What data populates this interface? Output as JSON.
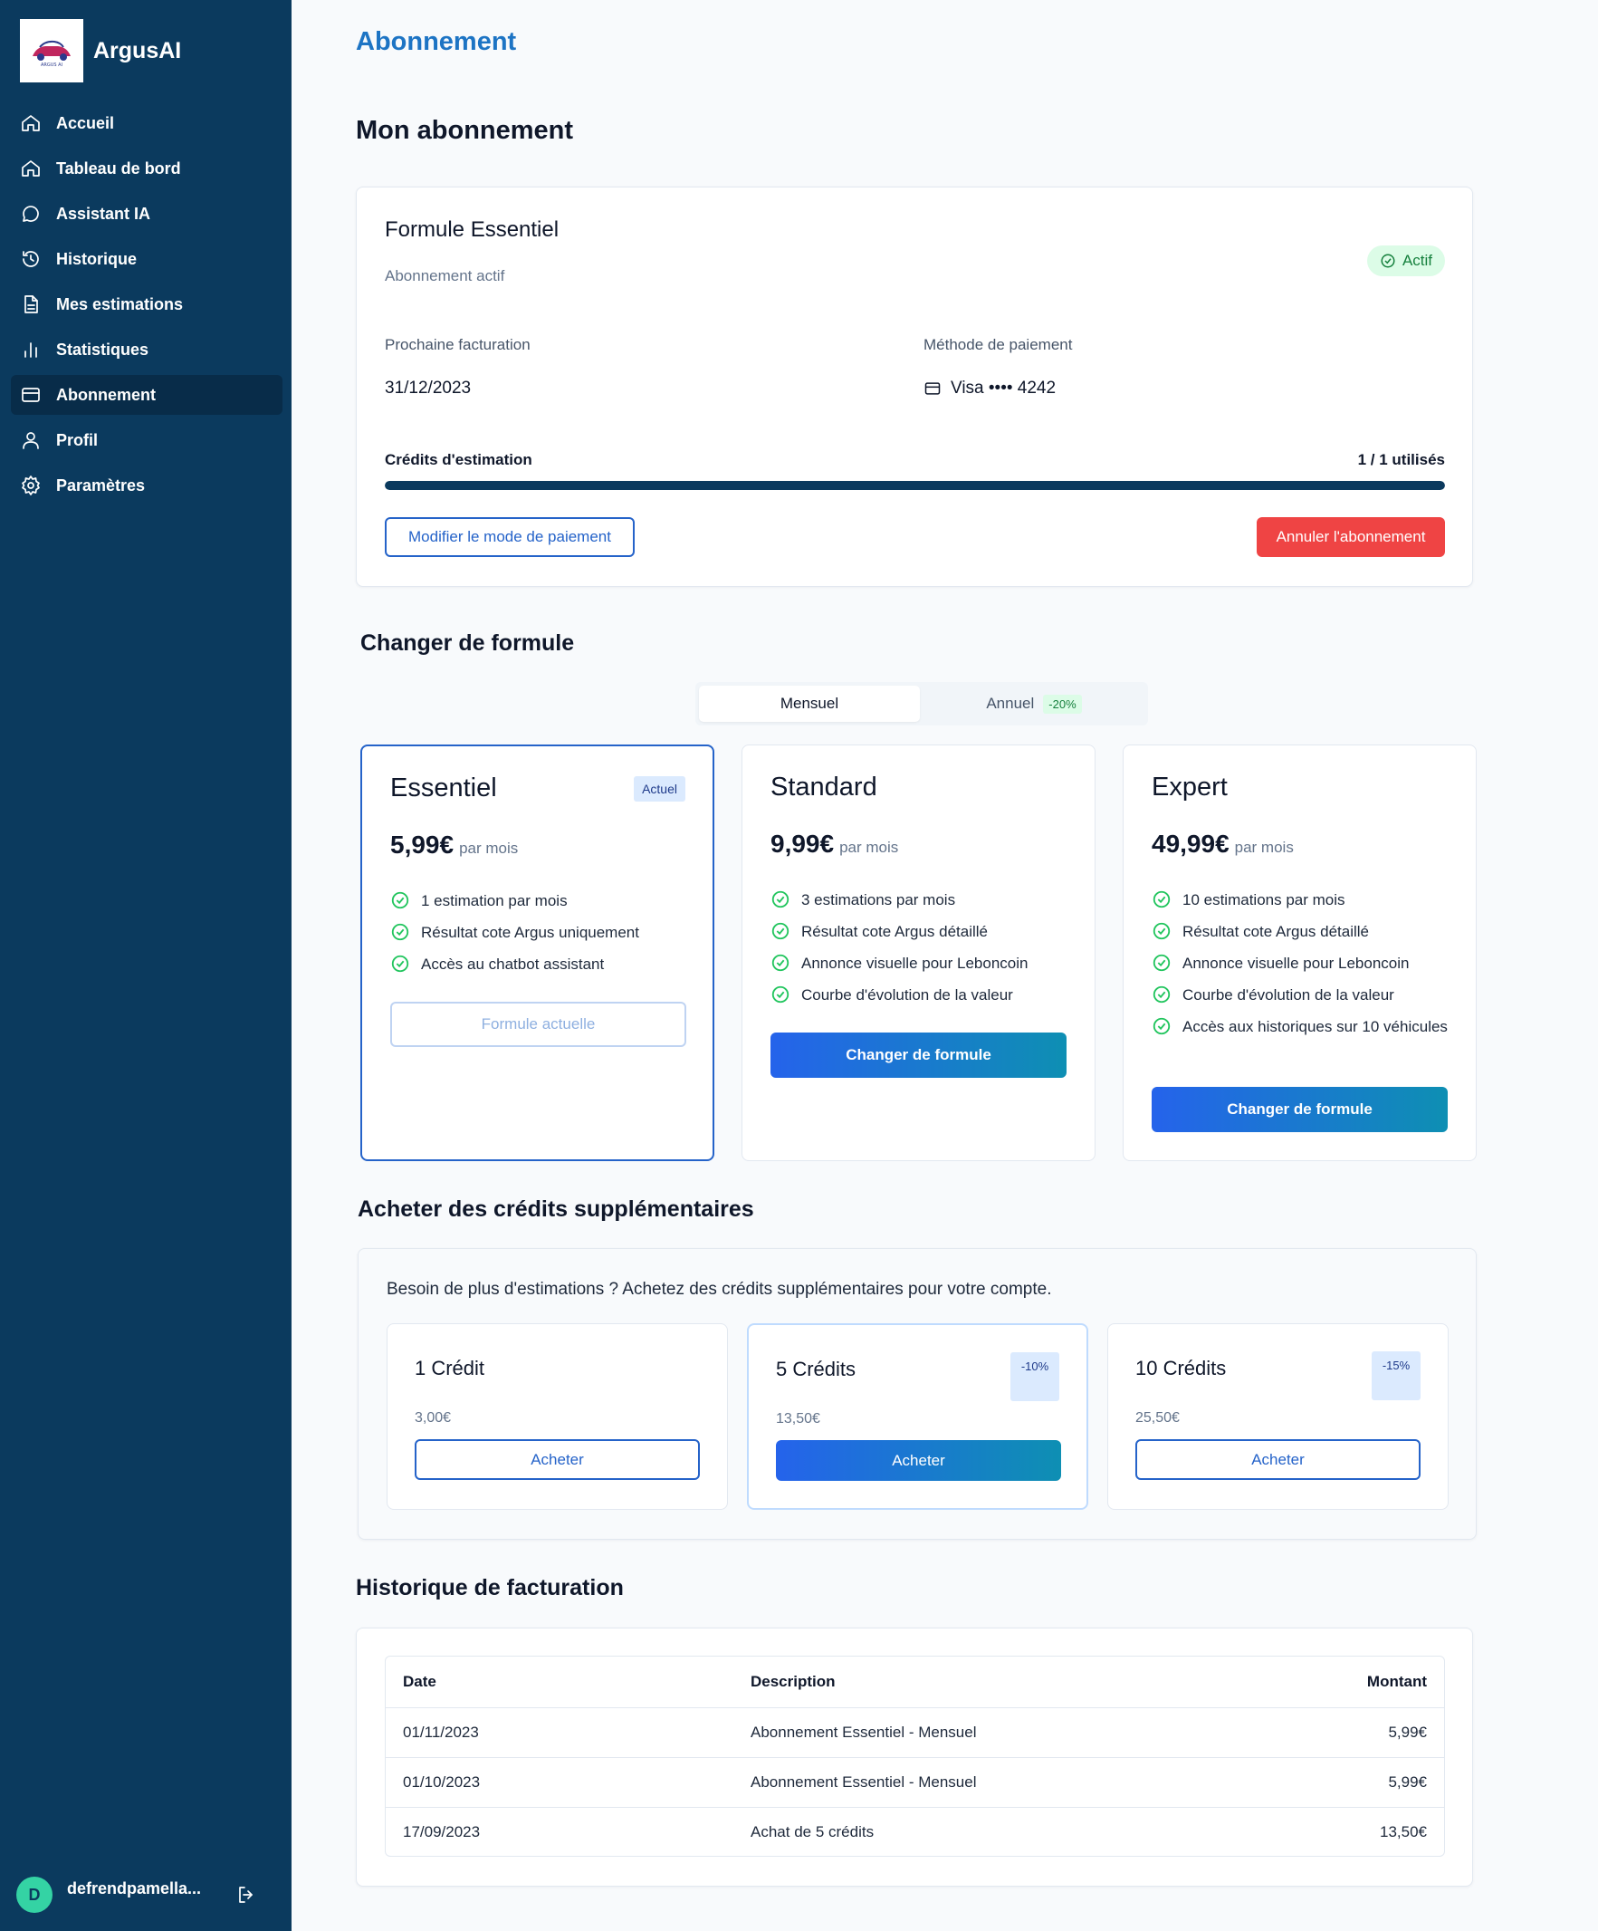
{
  "app": {
    "name": "ArgusAI",
    "logo_text": "ARGUS AI"
  },
  "sidebar": {
    "items": [
      {
        "label": "Accueil",
        "icon": "home-icon"
      },
      {
        "label": "Tableau de bord",
        "icon": "home-icon"
      },
      {
        "label": "Assistant IA",
        "icon": "chat-icon"
      },
      {
        "label": "Historique",
        "icon": "history-icon"
      },
      {
        "label": "Mes estimations",
        "icon": "document-icon"
      },
      {
        "label": "Statistiques",
        "icon": "bar-chart-icon"
      },
      {
        "label": "Abonnement",
        "icon": "credit-card-icon",
        "active": true
      },
      {
        "label": "Profil",
        "icon": "user-icon"
      },
      {
        "label": "Paramètres",
        "icon": "gear-icon"
      }
    ],
    "user": {
      "initial": "D",
      "name": "defrendpamella..."
    }
  },
  "page": {
    "title": "Abonnement"
  },
  "subscription": {
    "heading": "Mon abonnement",
    "plan_title": "Formule Essentiel",
    "status_text": "Abonnement actif",
    "badge": "Actif",
    "next_billing_label": "Prochaine facturation",
    "next_billing_value": "31/12/2023",
    "payment_label": "Méthode de paiement",
    "payment_value": "Visa •••• 4242",
    "credits_label": "Crédits d'estimation",
    "credits_used_text": "1 / 1 utilisés",
    "credits_used_fraction": 1.0,
    "modify_payment_button": "Modifier le mode de paiement",
    "cancel_button": "Annuler l'abonnement"
  },
  "change_plan": {
    "heading": "Changer de formule",
    "toggle": {
      "monthly": "Mensuel",
      "annual": "Annuel",
      "annual_discount": "-20%"
    },
    "plans": [
      {
        "name": "Essentiel",
        "badge": "Actuel",
        "price": "5,99€",
        "period": "par mois",
        "features": [
          "1 estimation par mois",
          "Résultat cote Argus uniquement",
          "Accès au chatbot assistant"
        ],
        "button": "Formule actuelle"
      },
      {
        "name": "Standard",
        "price": "9,99€",
        "period": "par mois",
        "features": [
          "3 estimations par mois",
          "Résultat cote Argus détaillé",
          "Annonce visuelle pour Leboncoin",
          "Courbe d'évolution de la valeur"
        ],
        "button": "Changer de formule"
      },
      {
        "name": "Expert",
        "price": "49,99€",
        "period": "par mois",
        "features": [
          "10 estimations par mois",
          "Résultat cote Argus détaillé",
          "Annonce visuelle pour Leboncoin",
          "Courbe d'évolution de la valeur",
          "Accès aux historiques sur 10 véhicules"
        ],
        "button": "Changer de formule"
      }
    ]
  },
  "credits": {
    "heading": "Acheter des crédits supplémentaires",
    "intro": "Besoin de plus d'estimations ? Achetez des crédits supplémentaires pour votre compte.",
    "packs": [
      {
        "name": "1 Crédit",
        "price": "3,00€",
        "button": "Acheter"
      },
      {
        "name": "5 Crédits",
        "price": "13,50€",
        "badge": "-10%",
        "button": "Acheter"
      },
      {
        "name": "10 Crédits",
        "price": "25,50€",
        "badge": "-15%",
        "button": "Acheter"
      }
    ]
  },
  "billing": {
    "heading": "Historique de facturation",
    "columns": [
      "Date",
      "Description",
      "Montant"
    ],
    "rows": [
      {
        "date": "01/11/2023",
        "description": "Abonnement Essentiel - Mensuel",
        "amount": "5,99€"
      },
      {
        "date": "01/10/2023",
        "description": "Abonnement Essentiel - Mensuel",
        "amount": "5,99€"
      },
      {
        "date": "17/09/2023",
        "description": "Achat de 5 crédits",
        "amount": "13,50€"
      }
    ]
  },
  "colors": {
    "sidebar_bg": "#0b3a5e",
    "accent_blue": "#2563c9",
    "title_blue": "#1d74c4",
    "danger": "#ef4444",
    "success": "#22c55e"
  }
}
